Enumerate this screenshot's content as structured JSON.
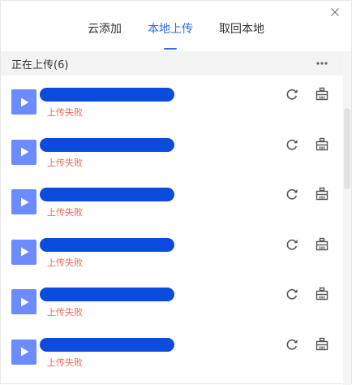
{
  "tabs": [
    {
      "label": "云添加"
    },
    {
      "label": "本地上传"
    },
    {
      "label": "取回本地"
    }
  ],
  "activeTab": 1,
  "section": {
    "title": "正在上传(6)"
  },
  "items": [
    {
      "status": "上传失败"
    },
    {
      "status": "上传失败"
    },
    {
      "status": "上传失败"
    },
    {
      "status": "上传失败"
    },
    {
      "status": "上传失败"
    },
    {
      "status": "上传失败"
    }
  ],
  "colors": {
    "accent": "#2e6bdc",
    "error": "#e36c56",
    "thumb": "#6b8bff",
    "redaction": "#0b4bde"
  },
  "icons": {
    "close": "close-icon",
    "more": "more-icon",
    "play": "play-icon",
    "retry": "retry-icon",
    "cancel": "cancel-icon"
  }
}
